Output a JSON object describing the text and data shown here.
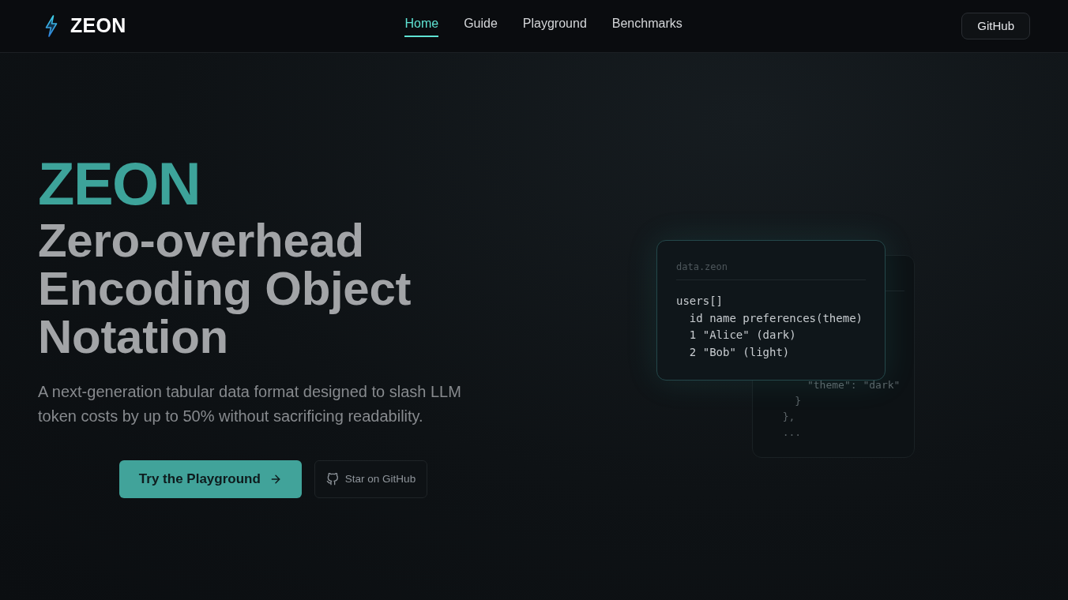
{
  "header": {
    "logo": "ZEON",
    "nav": [
      {
        "label": "Home",
        "selected": true
      },
      {
        "label": "Guide",
        "selected": false
      },
      {
        "label": "Playground",
        "selected": false
      },
      {
        "label": "Benchmarks",
        "selected": false
      }
    ],
    "github_button": "GitHub"
  },
  "hero": {
    "brand": "ZEON",
    "title": "Zero-overhead Encoding Object Notation",
    "description": "A next-generation tabular data format designed to slash LLM token costs by up to 50% without sacrificing readability.",
    "buttons": [
      {
        "kind": "primary",
        "label": "Try the Playground"
      },
      {
        "kind": "github",
        "label": "Star on GitHub"
      }
    ]
  },
  "code_preview": {
    "front_card": {
      "filename": "data.zeon",
      "lines": [
        "users[]",
        "  id name preferences(theme)",
        "  1 \"Alice\" (dark)",
        "  2 \"Bob\" (light)"
      ]
    },
    "back_card": {
      "lines": [
        "      \"theme\": \"dark\"",
        "    }",
        "  },",
        "  ..."
      ]
    }
  }
}
